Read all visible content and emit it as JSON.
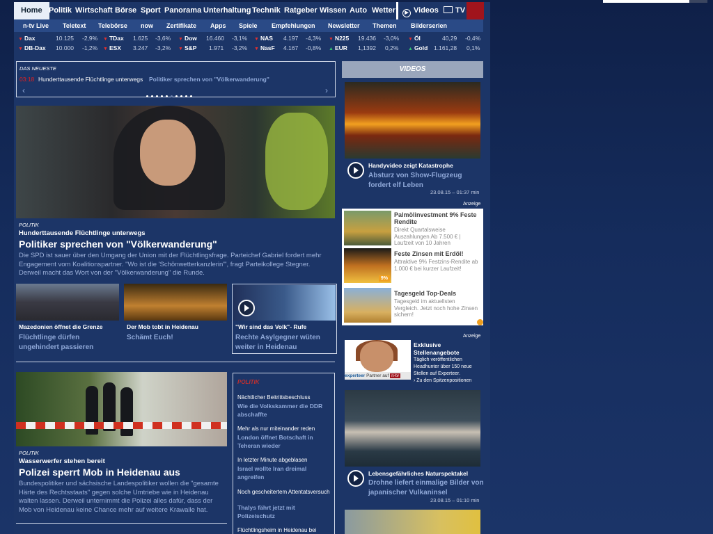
{
  "nav": {
    "main": [
      "Home",
      "Politik",
      "Wirtschaft",
      "Börse",
      "Sport",
      "Panorama",
      "Unterhaltung",
      "Technik",
      "Ratgeber",
      "Wissen",
      "Auto",
      "Wetter"
    ],
    "videos": "Videos",
    "tv": "TV"
  },
  "subnav": [
    "n-tv Live",
    "Teletext",
    "Telebörse",
    "now",
    "Zertifikate",
    "Apps",
    "Spiele",
    "Empfehlungen",
    "Newsletter",
    "Themen",
    "Bilderserien"
  ],
  "ticker": [
    {
      "name": "Dax",
      "value": "10.125",
      "change": "-2,9%",
      "dir": "down"
    },
    {
      "name": "TDax",
      "value": "1.625",
      "change": "-3,6%",
      "dir": "down"
    },
    {
      "name": "Dow",
      "value": "16.460",
      "change": "-3,1%",
      "dir": "down"
    },
    {
      "name": "NAS",
      "value": "4.197",
      "change": "-4,3%",
      "dir": "down"
    },
    {
      "name": "N225",
      "value": "19.436",
      "change": "-3,0%",
      "dir": "down"
    },
    {
      "name": "Öl",
      "value": "40,29",
      "change": "-0,4%",
      "dir": "down"
    },
    {
      "name": "DB-Dax",
      "value": "10.000",
      "change": "-1,2%",
      "dir": "down"
    },
    {
      "name": "ESX",
      "value": "3.247",
      "change": "-3,2%",
      "dir": "down"
    },
    {
      "name": "S&P",
      "value": "1.971",
      "change": "-3,2%",
      "dir": "down"
    },
    {
      "name": "NasF",
      "value": "4.167",
      "change": "-0,8%",
      "dir": "down"
    },
    {
      "name": "EUR",
      "value": "1,1392",
      "change": "0,2%",
      "dir": "up"
    },
    {
      "name": "Gold",
      "value": "1.161,28",
      "change": "0,1%",
      "dir": "up"
    }
  ],
  "newest": {
    "label": "DAS NEUESTE",
    "time": "03:18",
    "text1": "Hunderttausende Flüchtlinge unterwegs",
    "text2": "Politiker sprechen von \"Völkerwanderung\""
  },
  "hero": {
    "kicker": "POLITIK",
    "sub": "Hunderttausende Flüchtlinge unterwegs",
    "headline": "Politiker sprechen von \"Völkerwanderung\"",
    "body": "Die SPD ist sauer über den Umgang der Union mit der Flüchtlingsfrage. Parteichef Gabriel fordert mehr Engagement vom Koalitionspartner. \"Wo ist die 'Schönwetterkanzlerin'\", fragt Parteikollege Stegner. Derweil macht das Wort von der \"Völkerwanderung\" die Runde."
  },
  "tiles": [
    {
      "sub": "Mazedonien öffnet die Grenze",
      "head": "Flüchtlinge dürfen ungehindert passieren"
    },
    {
      "sub": "Der Mob tobt in Heidenau",
      "head": "Schämt Euch!"
    },
    {
      "sub": "\"Wir sind das Volk\"- Rufe",
      "head": "Rechte Asylgegner wüten weiter in Heidenau"
    }
  ],
  "lead2": {
    "kicker": "POLITIK",
    "sub": "Wasserwerfer stehen bereit",
    "headline": "Polizei sperrt Mob in Heidenau aus",
    "body": "Bundespolitiker und sächsische Landespolitiker wollen die \"gesamte Härte des Rechtsstaats\" gegen solche Umtriebe wie in Heidenau walten lassen. Derweil unternimmt die Polizei alles dafür, dass der Mob von Heidenau keine Chance mehr auf weitere Krawalle hat."
  },
  "list": {
    "label": "POLITIK",
    "items": [
      {
        "sub": "Nächtlicher Beitrittsbeschluss",
        "head": "Wie die Volkskammer die DDR abschaffte"
      },
      {
        "sub": "Mehr als nur miteinander reden",
        "head": "London öffnet Botschaft in Teheran wieder"
      },
      {
        "sub": "In letzter Minute abgeblasen",
        "head": "Israel wollte Iran dreimal angreifen"
      },
      {
        "sub": "Noch gescheitertem Attentatsversuch",
        "head": "Thalys fährt jetzt mit Polizeischutz"
      },
      {
        "sub": "Flüchtlingsheim in Heidenau bei",
        "head": ""
      }
    ]
  },
  "videos": {
    "label": "VIDEOS",
    "v1": {
      "sub": "Handyvideo zeigt Katastrophe",
      "head": "Absturz von Show-Flugzeug fordert elf Leben",
      "time": "23.08.15 – 01:37 min"
    },
    "v2": {
      "sub": "Lebensgefährliches Naturspektakel",
      "head": "Drohne liefert einmalige Bilder von japanischer Vulkaninsel",
      "time": "23.08.15 – 01:10 min"
    }
  },
  "ads": {
    "label": "Anzeige",
    "items": [
      {
        "title": "Palmölinvestment 9% Feste Rendite",
        "body": "Direkt Quartalsweise Auszahlungen Ab 7.500 € | Laufzeit von 10 Jahren"
      },
      {
        "title": "Feste Zinsen mit Erdöl!",
        "body": "Attraktive 9% Festzins-Rendite ab 1.000 € bei kurzer Laufzeit!"
      },
      {
        "title": "Tagesgeld Top-Deals",
        "body": "Tagesgeld im aktuellsten Vergleich. Jetzt noch hohe Zinsen sichern!"
      }
    ],
    "badge": "9%"
  },
  "job": {
    "label": "Anzeige",
    "title": "Exklusive Stellenangebote",
    "body": "Täglich veröffentlichen Headhunter über 150 neue Stellen auf Experteer.",
    "link": "› Zu den Spitzenpositionen",
    "brand": "experteer",
    "partner": "Partner auf"
  }
}
